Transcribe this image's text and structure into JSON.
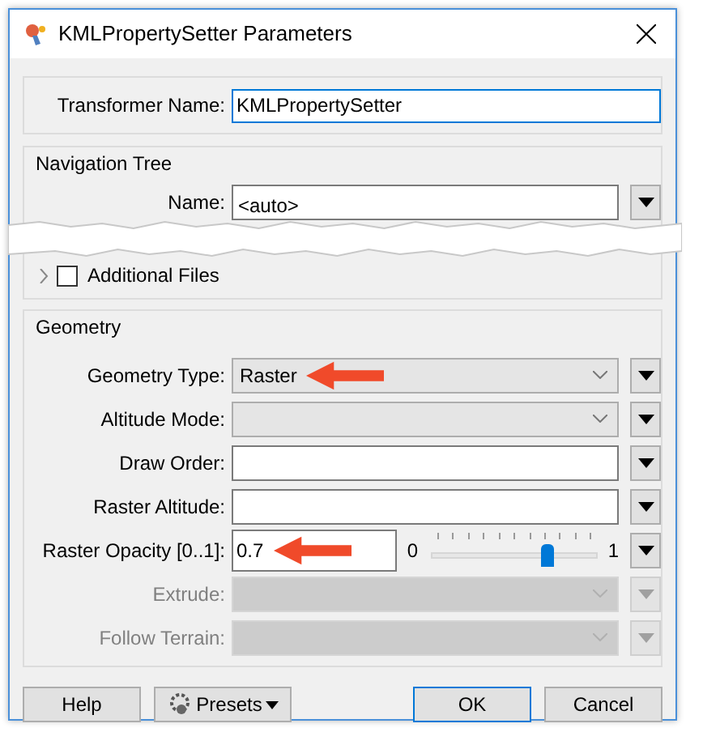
{
  "window": {
    "title": "KMLPropertySetter Parameters"
  },
  "transformer_name": {
    "label": "Transformer Name:",
    "value": "KMLPropertySetter"
  },
  "navigation_tree": {
    "title": "Navigation Tree",
    "name_label": "Name:",
    "name_value": "<auto>",
    "additional_files": {
      "label": "Additional Files",
      "checked": false,
      "expanded": false
    }
  },
  "geometry": {
    "title": "Geometry",
    "rows": [
      {
        "kind": "select",
        "label": "Geometry Type:",
        "value": "Raster",
        "disabled": false,
        "annotated": true
      },
      {
        "kind": "select",
        "label": "Altitude Mode:",
        "disabled": false,
        "annotated": false
      },
      {
        "kind": "text",
        "label": "Draw Order:",
        "disabled": false,
        "annotated": false
      },
      {
        "kind": "text",
        "label": "Raster Altitude:",
        "disabled": false,
        "annotated": false
      },
      {
        "kind": "slider",
        "label": "Raster Opacity [0..1]:",
        "value": "0.7",
        "min_label": "0",
        "max_label": "1",
        "level": 0.7,
        "disabled": false,
        "annotated": true
      },
      {
        "kind": "select",
        "label": "Extrude:",
        "disabled": true,
        "annotated": false
      },
      {
        "kind": "select",
        "label": "Follow Terrain:",
        "disabled": true,
        "annotated": false
      }
    ]
  },
  "buttons": [
    {
      "kind": "plain",
      "label": "Help",
      "default": false
    },
    {
      "kind": "menu",
      "label": "Presets",
      "default": false
    },
    {
      "kind": "plain",
      "label": "OK",
      "default": true
    },
    {
      "kind": "plain",
      "label": "Cancel",
      "default": false
    }
  ]
}
